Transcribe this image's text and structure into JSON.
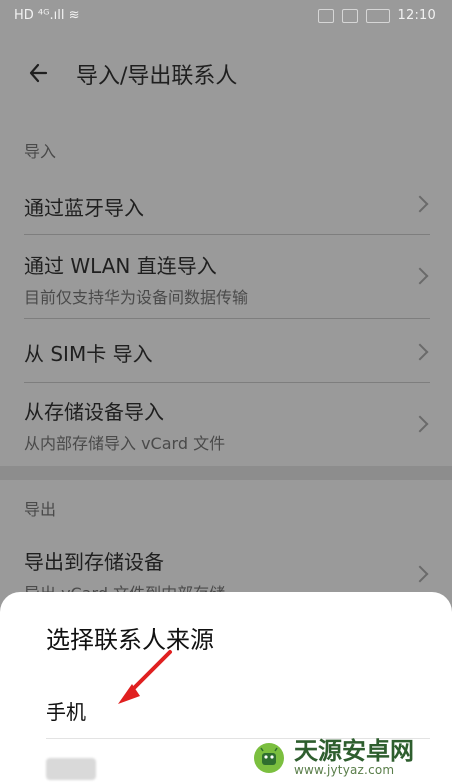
{
  "status_bar": {
    "left_indicators": "HD ⁴ᴳ.ıll ≋",
    "time": "12:10"
  },
  "header": {
    "title": "导入/导出联系人"
  },
  "import_section": {
    "label": "导入",
    "items": [
      {
        "title": "通过蓝牙导入",
        "subtitle": ""
      },
      {
        "title": "通过 WLAN 直连导入",
        "subtitle": "目前仅支持华为设备间数据传输"
      },
      {
        "title": "从 SIM卡 导入",
        "subtitle": ""
      },
      {
        "title": "从存储设备导入",
        "subtitle": "从内部存储导入 vCard 文件"
      }
    ]
  },
  "export_section": {
    "label": "导出",
    "items": [
      {
        "title": "导出到存储设备",
        "subtitle": "导出 vCard 文件到内部存储"
      }
    ]
  },
  "bottom_sheet": {
    "title": "选择联系人来源",
    "items": [
      {
        "label": "手机"
      }
    ]
  },
  "watermark": {
    "name": "天源安卓网",
    "url": "www.jytyaz.com"
  },
  "colors": {
    "overlay_bg": "#9a9a9a",
    "sheet_bg": "#ffffff",
    "arrow": "#e02020"
  }
}
